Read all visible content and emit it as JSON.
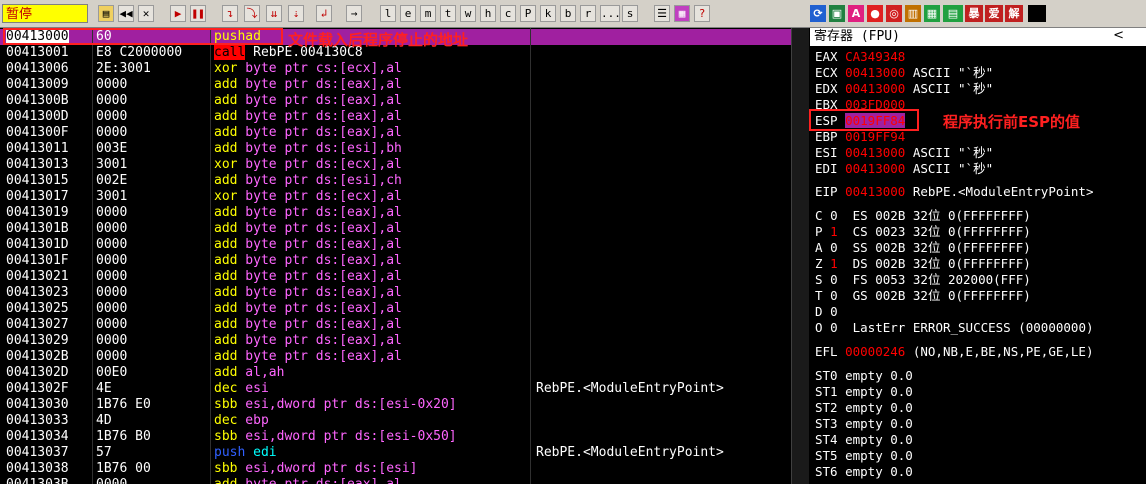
{
  "toolbar": {
    "status": "暂停",
    "buttons": [
      "l",
      "e",
      "m",
      "t",
      "w",
      "h",
      "c",
      "P",
      "k",
      "b",
      "r",
      "...",
      "s"
    ],
    "plugins": [
      "暴",
      "爱",
      "解"
    ]
  },
  "disasm": {
    "rows": [
      {
        "addr": "00413000",
        "hex": "60",
        "asm": "pushad",
        "comment": "",
        "cls": "rp",
        "sel": true
      },
      {
        "addr": "00413001",
        "hex": "E8 C2000000",
        "asm": "call RebPE.004130C8",
        "comment": "",
        "cls": "call"
      },
      {
        "addr": "00413006",
        "hex": "2E:3001",
        "asm": "xor byte ptr cs:[ecx],al",
        "comment": "",
        "cls": "ry"
      },
      {
        "addr": "00413009",
        "hex": "0000",
        "asm": "add byte ptr ds:[eax],al",
        "comment": "",
        "cls": "ry"
      },
      {
        "addr": "0041300B",
        "hex": "0000",
        "asm": "add byte ptr ds:[eax],al",
        "comment": "",
        "cls": "ry"
      },
      {
        "addr": "0041300D",
        "hex": "0000",
        "asm": "add byte ptr ds:[eax],al",
        "comment": "",
        "cls": "ry"
      },
      {
        "addr": "0041300F",
        "hex": "0000",
        "asm": "add byte ptr ds:[eax],al",
        "comment": "",
        "cls": "ry"
      },
      {
        "addr": "00413011",
        "hex": "003E",
        "asm": "add byte ptr ds:[esi],bh",
        "comment": "",
        "cls": "ry"
      },
      {
        "addr": "00413013",
        "hex": "3001",
        "asm": "xor byte ptr ds:[ecx],al",
        "comment": "",
        "cls": "ry"
      },
      {
        "addr": "00413015",
        "hex": "002E",
        "asm": "add byte ptr ds:[esi],ch",
        "comment": "",
        "cls": "ry"
      },
      {
        "addr": "00413017",
        "hex": "3001",
        "asm": "xor byte ptr ds:[ecx],al",
        "comment": "",
        "cls": "ry"
      },
      {
        "addr": "00413019",
        "hex": "0000",
        "asm": "add byte ptr ds:[eax],al",
        "comment": "",
        "cls": "ry"
      },
      {
        "addr": "0041301B",
        "hex": "0000",
        "asm": "add byte ptr ds:[eax],al",
        "comment": "",
        "cls": "ry"
      },
      {
        "addr": "0041301D",
        "hex": "0000",
        "asm": "add byte ptr ds:[eax],al",
        "comment": "",
        "cls": "ry"
      },
      {
        "addr": "0041301F",
        "hex": "0000",
        "asm": "add byte ptr ds:[eax],al",
        "comment": "",
        "cls": "ry"
      },
      {
        "addr": "00413021",
        "hex": "0000",
        "asm": "add byte ptr ds:[eax],al",
        "comment": "",
        "cls": "ry"
      },
      {
        "addr": "00413023",
        "hex": "0000",
        "asm": "add byte ptr ds:[eax],al",
        "comment": "",
        "cls": "ry"
      },
      {
        "addr": "00413025",
        "hex": "0000",
        "asm": "add byte ptr ds:[eax],al",
        "comment": "",
        "cls": "ry"
      },
      {
        "addr": "00413027",
        "hex": "0000",
        "asm": "add byte ptr ds:[eax],al",
        "comment": "",
        "cls": "ry"
      },
      {
        "addr": "00413029",
        "hex": "0000",
        "asm": "add byte ptr ds:[eax],al",
        "comment": "",
        "cls": "ry"
      },
      {
        "addr": "0041302B",
        "hex": "0000",
        "asm": "add byte ptr ds:[eax],al",
        "comment": "",
        "cls": "ry"
      },
      {
        "addr": "0041302D",
        "hex": "00E0",
        "asm": "add al,ah",
        "comment": "",
        "cls": "ry"
      },
      {
        "addr": "0041302F",
        "hex": "4E",
        "asm": "dec esi",
        "comment": "RebPE.<ModuleEntryPoint>",
        "cls": "ry"
      },
      {
        "addr": "00413030",
        "hex": "1B76 E0",
        "asm": "sbb esi,dword ptr ds:[esi-0x20]",
        "comment": "",
        "cls": "ry"
      },
      {
        "addr": "00413033",
        "hex": "4D",
        "asm": "dec ebp",
        "comment": "",
        "cls": "ry"
      },
      {
        "addr": "00413034",
        "hex": "1B76 B0",
        "asm": "sbb esi,dword ptr ds:[esi-0x50]",
        "comment": "",
        "cls": "ry"
      },
      {
        "addr": "00413037",
        "hex": "57",
        "asm": "push edi",
        "comment": "RebPE.<ModuleEntryPoint>",
        "cls": "push"
      },
      {
        "addr": "00413038",
        "hex": "1B76 00",
        "asm": "sbb esi,dword ptr ds:[esi]",
        "comment": "",
        "cls": "ry"
      },
      {
        "addr": "0041303B",
        "hex": "0000",
        "asm": "add byte ptr ds:[eax],al",
        "comment": "",
        "cls": "ry"
      }
    ]
  },
  "registers": {
    "header": "寄存器 (FPU)",
    "chevron": "<",
    "gp": [
      {
        "name": "EAX",
        "value": "CA349348",
        "extra": ""
      },
      {
        "name": "ECX",
        "value": "00413000",
        "extra": "ASCII \"`秒\""
      },
      {
        "name": "EDX",
        "value": "00413000",
        "extra": "ASCII \"`秒\""
      },
      {
        "name": "EBX",
        "value": "003FD000",
        "extra": ""
      },
      {
        "name": "ESP",
        "value": "0019FF84",
        "extra": ""
      },
      {
        "name": "EBP",
        "value": "0019FF94",
        "extra": ""
      },
      {
        "name": "ESI",
        "value": "00413000",
        "extra": "ASCII \"`秒\""
      },
      {
        "name": "EDI",
        "value": "00413000",
        "extra": "ASCII \"`秒\""
      }
    ],
    "eip": {
      "name": "EIP",
      "value": "00413000",
      "extra": "RebPE.<ModuleEntryPoint>"
    },
    "flags": [
      {
        "f": "C",
        "v": "0",
        "seg": "ES",
        "sv": "002B",
        "bits": "32位",
        "range": "0(FFFFFFFF)"
      },
      {
        "f": "P",
        "v": "1",
        "seg": "CS",
        "sv": "0023",
        "bits": "32位",
        "range": "0(FFFFFFFF)"
      },
      {
        "f": "A",
        "v": "0",
        "seg": "SS",
        "sv": "002B",
        "bits": "32位",
        "range": "0(FFFFFFFF)"
      },
      {
        "f": "Z",
        "v": "1",
        "seg": "DS",
        "sv": "002B",
        "bits": "32位",
        "range": "0(FFFFFFFF)"
      },
      {
        "f": "S",
        "v": "0",
        "seg": "FS",
        "sv": "0053",
        "bits": "32位",
        "range": "202000(FFF)"
      },
      {
        "f": "T",
        "v": "0",
        "seg": "GS",
        "sv": "002B",
        "bits": "32位",
        "range": "0(FFFFFFFF)"
      },
      {
        "f": "D",
        "v": "0",
        "seg": "",
        "sv": "",
        "bits": "",
        "range": ""
      },
      {
        "f": "O",
        "v": "0",
        "seg": "LastErr",
        "sv": "ERROR_SUCCESS (00000000)",
        "bits": "",
        "range": ""
      }
    ],
    "efl": {
      "name": "EFL",
      "value": "00000246",
      "extra": "(NO,NB,E,BE,NS,PE,GE,LE)"
    },
    "fpu": [
      "ST0 empty 0.0",
      "ST1 empty 0.0",
      "ST2 empty 0.0",
      "ST3 empty 0.0",
      "ST4 empty 0.0",
      "ST5 empty 0.0",
      "ST6 empty 0.0"
    ]
  },
  "annotations": {
    "entry": "文件载入后程序停止的地址",
    "esp": "程序执行前ESP的值"
  }
}
